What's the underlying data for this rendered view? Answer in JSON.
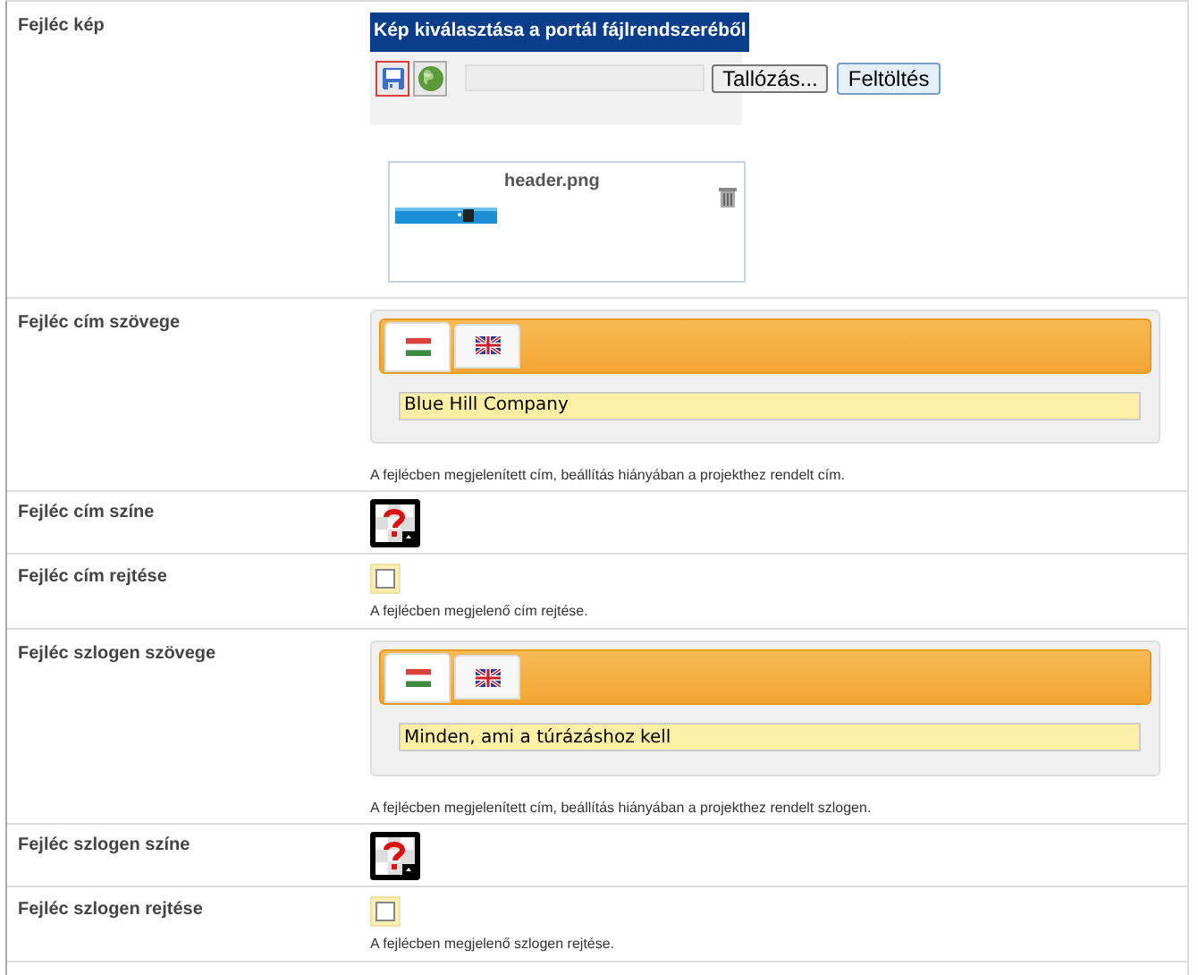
{
  "rows": [
    {
      "label": "Fejléc kép",
      "picker": {
        "title": "Kép kiválasztása a portál fájlrendszeréből",
        "sources": [
          {
            "kind": "disk",
            "selected": true
          },
          {
            "kind": "web",
            "selected": false
          }
        ],
        "browse": "Tallózás...",
        "upload": "Feltöltés"
      },
      "file": {
        "name": "header.png",
        "kind": "picture"
      }
    },
    {
      "kind": "text",
      "label": "Fejléc cím szövege",
      "tabs": [
        {
          "kind": "hu",
          "selected": true
        },
        {
          "kind": "en",
          "selected": false
        }
      ],
      "value": "Blue Hill Company",
      "hint": "A fejlécben megjelenített cím, beállítás hiányában a projekthez rendelt cím."
    },
    {
      "kind": "color",
      "label": "Fejléc cím színe"
    },
    {
      "kind": "checkbox",
      "label": "Fejléc cím rejtése",
      "checked": false,
      "hint": "A fejlécben megjelenő cím rejtése."
    },
    {
      "kind": "text",
      "label": "Fejléc szlogen szövege",
      "tabs": [
        {
          "kind": "hu",
          "selected": true
        },
        {
          "kind": "en",
          "selected": false
        }
      ],
      "value": "Minden, ami a túrázáshoz kell",
      "hint": "A fejlécben megjelenített cím, beállítás hiányában a projekthez rendelt szlogen."
    },
    {
      "kind": "color",
      "label": "Fejléc szlogen színe"
    },
    {
      "kind": "checkbox",
      "label": "Fejléc szlogen rejtése",
      "checked": false,
      "hint": "A fejlécben megjelenő szlogen rejtése."
    }
  ]
}
